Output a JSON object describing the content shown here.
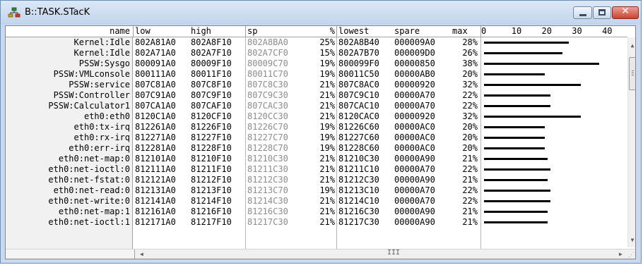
{
  "window": {
    "title": "B::TASK.STacK"
  },
  "icons": {
    "app": "network-nodes-icon",
    "minimize": "minimize-icon",
    "maximize": "maximize-icon",
    "close": "close-icon"
  },
  "columns": {
    "name": "name",
    "low": "low",
    "high": "high",
    "sp": "sp",
    "pct": "%",
    "lowest": "lowest",
    "spare": "spare",
    "max": "max"
  },
  "scale": {
    "ticks": [
      "0",
      "10",
      "20",
      "30",
      "40"
    ],
    "max": 47
  },
  "rows": [
    {
      "name": "Kernel:Idle",
      "low": "802A81A0",
      "high": "802A8F10",
      "sp": "802A8BA0",
      "pct": "25%",
      "lowest": "802A8B40",
      "spare": "000009A0",
      "max": "28%",
      "maxval": 28
    },
    {
      "name": "Kernel:Idle",
      "low": "802A71A0",
      "high": "802A7F10",
      "sp": "802A7CF0",
      "pct": "15%",
      "lowest": "802A7B70",
      "spare": "000009D0",
      "max": "26%",
      "maxval": 26
    },
    {
      "name": "PSSW:Sysgo",
      "low": "800091A0",
      "high": "80009F10",
      "sp": "80009C70",
      "pct": "19%",
      "lowest": "800099F0",
      "spare": "00000850",
      "max": "38%",
      "maxval": 38
    },
    {
      "name": "PSSW:VMLconsole",
      "low": "800111A0",
      "high": "80011F10",
      "sp": "80011C70",
      "pct": "19%",
      "lowest": "80011C50",
      "spare": "00000AB0",
      "max": "20%",
      "maxval": 20
    },
    {
      "name": "PSSW:service",
      "low": "807C81A0",
      "high": "807C8F10",
      "sp": "807C8C30",
      "pct": "21%",
      "lowest": "807C8AC0",
      "spare": "00000920",
      "max": "32%",
      "maxval": 32
    },
    {
      "name": "PSSW:Controller",
      "low": "807C91A0",
      "high": "807C9F10",
      "sp": "807C9C30",
      "pct": "21%",
      "lowest": "807C9C10",
      "spare": "00000A70",
      "max": "22%",
      "maxval": 22
    },
    {
      "name": "PSSW:Calculator1",
      "low": "807CA1A0",
      "high": "807CAF10",
      "sp": "807CAC30",
      "pct": "21%",
      "lowest": "807CAC10",
      "spare": "00000A70",
      "max": "22%",
      "maxval": 22
    },
    {
      "name": "eth0:eth0",
      "low": "8120C1A0",
      "high": "8120CF10",
      "sp": "8120CC30",
      "pct": "21%",
      "lowest": "8120CAC0",
      "spare": "00000920",
      "max": "32%",
      "maxval": 32
    },
    {
      "name": "eth0:tx-irq",
      "low": "812261A0",
      "high": "81226F10",
      "sp": "81226C70",
      "pct": "19%",
      "lowest": "81226C60",
      "spare": "00000AC0",
      "max": "20%",
      "maxval": 20
    },
    {
      "name": "eth0:rx-irq",
      "low": "812271A0",
      "high": "81227F10",
      "sp": "81227C70",
      "pct": "19%",
      "lowest": "81227C60",
      "spare": "00000AC0",
      "max": "20%",
      "maxval": 20
    },
    {
      "name": "eth0:err-irq",
      "low": "812281A0",
      "high": "81228F10",
      "sp": "81228C70",
      "pct": "19%",
      "lowest": "81228C60",
      "spare": "00000AC0",
      "max": "20%",
      "maxval": 20
    },
    {
      "name": "eth0:net-map:0",
      "low": "812101A0",
      "high": "81210F10",
      "sp": "81210C30",
      "pct": "21%",
      "lowest": "81210C30",
      "spare": "00000A90",
      "max": "21%",
      "maxval": 21
    },
    {
      "name": "eth0:net-ioctl:0",
      "low": "812111A0",
      "high": "81211F10",
      "sp": "81211C30",
      "pct": "21%",
      "lowest": "81211C10",
      "spare": "00000A70",
      "max": "22%",
      "maxval": 22
    },
    {
      "name": "eth0:net-fstat:0",
      "low": "812121A0",
      "high": "81212F10",
      "sp": "81212C30",
      "pct": "21%",
      "lowest": "81212C30",
      "spare": "00000A90",
      "max": "21%",
      "maxval": 21
    },
    {
      "name": "eth0:net-read:0",
      "low": "812131A0",
      "high": "81213F10",
      "sp": "81213C70",
      "pct": "19%",
      "lowest": "81213C10",
      "spare": "00000A70",
      "max": "22%",
      "maxval": 22
    },
    {
      "name": "eth0:net-write:0",
      "low": "812141A0",
      "high": "81214F10",
      "sp": "81214C30",
      "pct": "21%",
      "lowest": "81214C10",
      "spare": "00000A70",
      "max": "22%",
      "maxval": 22
    },
    {
      "name": "eth0:net-map:1",
      "low": "812161A0",
      "high": "81216F10",
      "sp": "81216C30",
      "pct": "21%",
      "lowest": "81216C30",
      "spare": "00000A90",
      "max": "21%",
      "maxval": 21
    },
    {
      "name": "eth0:net-ioctl:1",
      "low": "812171A0",
      "high": "81217F10",
      "sp": "81217C30",
      "pct": "21%",
      "lowest": "81217C30",
      "spare": "00000A90",
      "max": "21%",
      "maxval": 21
    }
  ],
  "scrollbar": {
    "hscroll_grip": "III",
    "up": "up-arrow-icon",
    "down": "down-arrow-icon",
    "left": "left-arrow-icon",
    "right": "right-arrow-icon"
  }
}
